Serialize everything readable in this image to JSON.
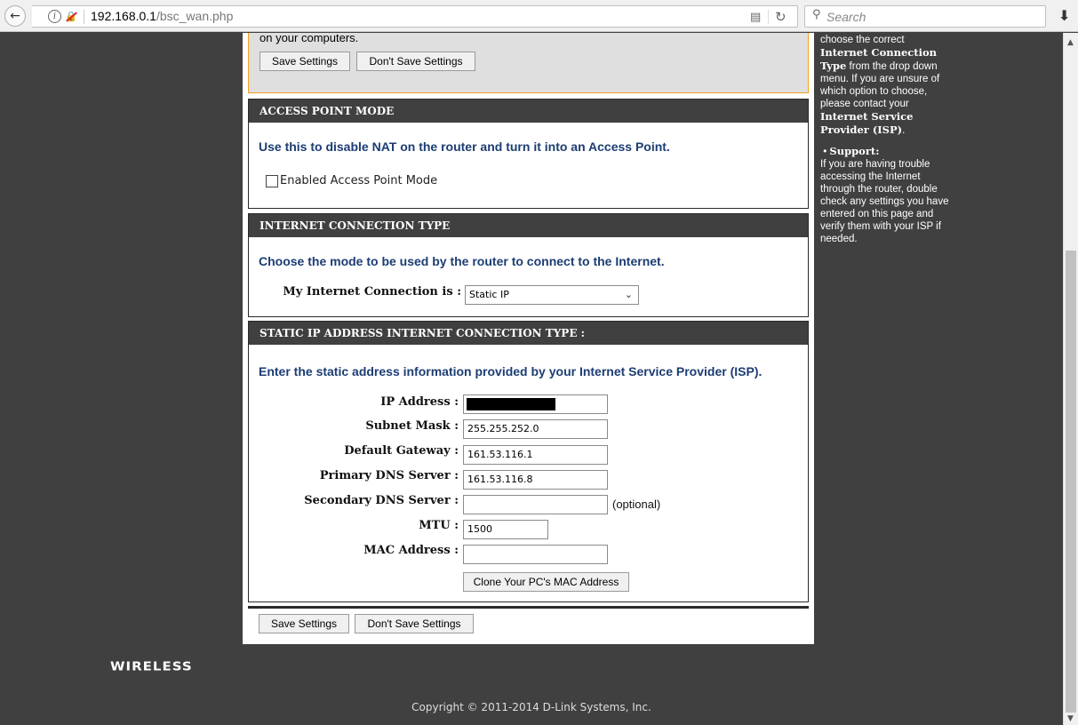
{
  "browser": {
    "url_main": "192.168.0.1",
    "url_path": "/bsc_wan.php",
    "search_placeholder": "Search"
  },
  "top_box": {
    "partial_text": "on your computers.",
    "save_label": "Save Settings",
    "dont_save_label": "Don't Save Settings"
  },
  "access_point": {
    "title": "ACCESS POINT MODE",
    "description": "Use this to disable NAT on the router and turn it into an Access Point.",
    "checkbox_label": "Enabled Access Point Mode",
    "checked": false
  },
  "internet_connection": {
    "title": "INTERNET CONNECTION TYPE",
    "description": "Choose the mode to be used by the router to connect to the Internet.",
    "label": "My Internet Connection is :",
    "selected": "Static IP"
  },
  "static_ip": {
    "title": "STATIC IP ADDRESS INTERNET CONNECTION TYPE :",
    "description": "Enter the static address information provided by your Internet Service Provider (ISP).",
    "fields": {
      "ip_address": {
        "label": "IP Address :",
        "value": ""
      },
      "subnet_mask": {
        "label": "Subnet Mask :",
        "value": "255.255.252.0"
      },
      "default_gateway": {
        "label": "Default Gateway :",
        "value": "161.53.116.1"
      },
      "primary_dns": {
        "label": "Primary DNS Server :",
        "value": "161.53.116.8"
      },
      "secondary_dns": {
        "label": "Secondary DNS Server :",
        "value": "",
        "suffix": "(optional)"
      },
      "mtu": {
        "label": "MTU :",
        "value": "1500"
      },
      "mac_address": {
        "label": "MAC Address :",
        "value": ""
      }
    },
    "clone_mac_label": "Clone Your PC's MAC Address"
  },
  "bottom_buttons": {
    "save_label": "Save Settings",
    "dont_save_label": "Don't Save Settings"
  },
  "help": {
    "line1": "choose the correct",
    "bold1": "Internet Connection Type",
    "line2": " from the drop down menu. If you are unsure of which option to choose, please contact your ",
    "bold2": "Internet Service Provider (ISP)",
    "line3": ".",
    "support_title": "Support:",
    "support_text": "If you are having trouble accessing the Internet through the router, double check any settings you have entered on this page and verify them with your ISP if needed."
  },
  "footer": {
    "brand": "WIRELESS",
    "copyright": "Copyright © 2011-2014 D-Link Systems, Inc."
  }
}
